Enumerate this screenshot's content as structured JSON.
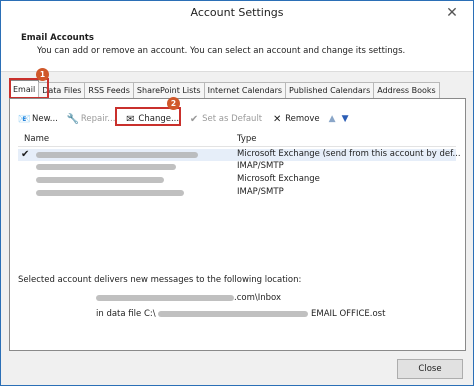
{
  "window": {
    "title": "Account Settings",
    "close_glyph": "✕"
  },
  "header": {
    "title": "Email Accounts",
    "description": "You can add or remove an account. You can select an account and change its settings."
  },
  "tabs": [
    {
      "label": "Email"
    },
    {
      "label": "Data Files"
    },
    {
      "label": "RSS Feeds"
    },
    {
      "label": "SharePoint Lists"
    },
    {
      "label": "Internet Calendars"
    },
    {
      "label": "Published Calendars"
    },
    {
      "label": "Address Books"
    }
  ],
  "badges": {
    "one": "1",
    "two": "2"
  },
  "toolbar": {
    "new_label": "New...",
    "repair_label": "Repair...",
    "change_label": "Change...",
    "default_label": "Set as Default",
    "remove_label": "Remove",
    "move_up": "▲",
    "move_down": "▼"
  },
  "list": {
    "col_name": "Name",
    "col_type": "Type",
    "rows": [
      {
        "type": "Microsoft Exchange (send from this account by def...",
        "default": true
      },
      {
        "type": "IMAP/SMTP"
      },
      {
        "type": "Microsoft Exchange"
      },
      {
        "type": "IMAP/SMTP"
      }
    ]
  },
  "location": {
    "label": "Selected account delivers new messages to the following location:",
    "folder_suffix": ".com\\Inbox",
    "datafile_prefix": "in data file C:\\",
    "datafile_suffix": "EMAIL OFFICE.ost"
  },
  "footer": {
    "close_label": "Close"
  }
}
